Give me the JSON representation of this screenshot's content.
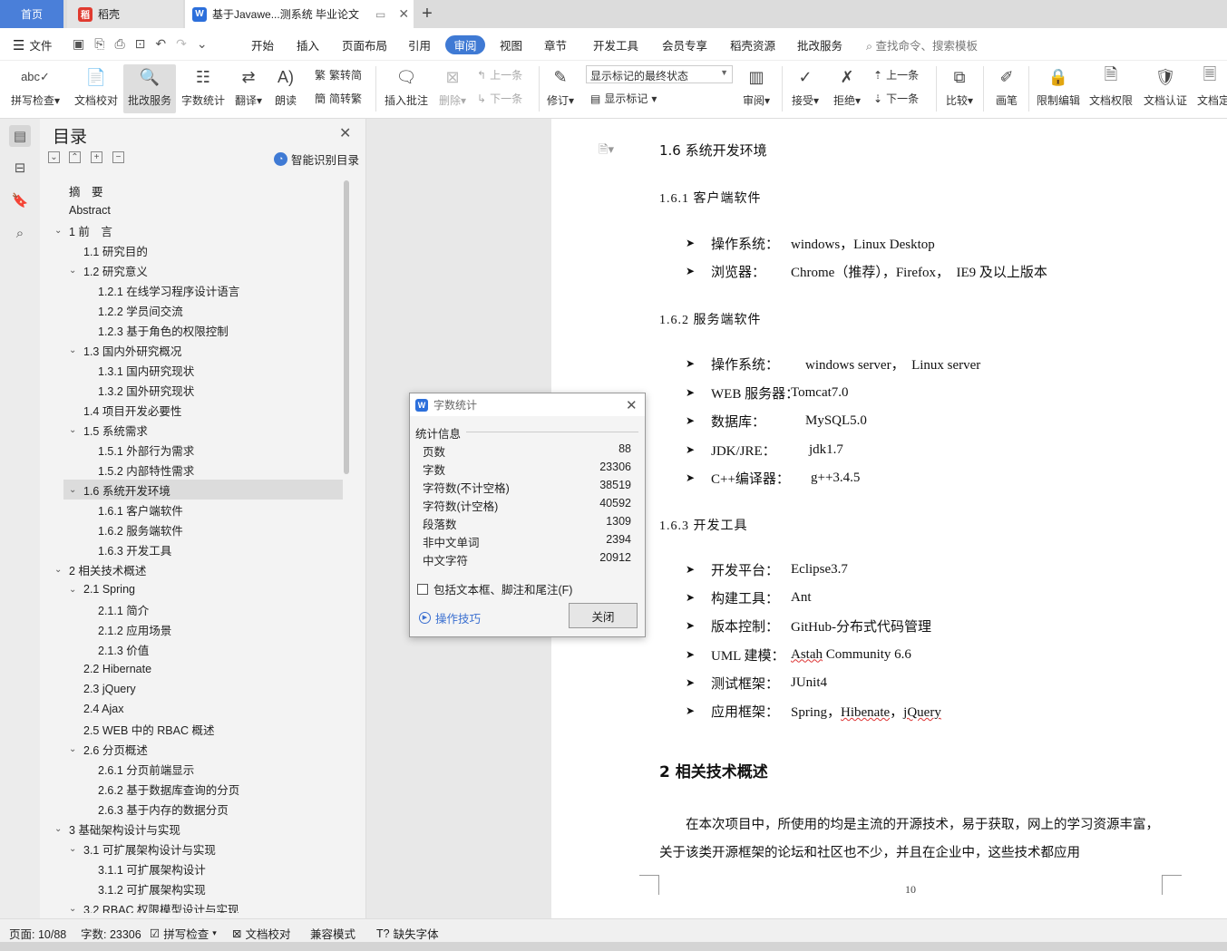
{
  "tabs": {
    "home": "首页",
    "daoke": "稻壳",
    "doc": "基于Javawe...测系统 毕业论文"
  },
  "menu": {
    "file": "文件",
    "items": [
      "开始",
      "插入",
      "页面布局",
      "引用",
      "审阅",
      "视图",
      "章节",
      "开发工具",
      "会员专享",
      "稻壳资源",
      "批改服务"
    ],
    "active": "审阅",
    "search": "查找命令、搜索模板"
  },
  "ribbon": {
    "spell_check": "拼写检查",
    "doc_check": "文档校对",
    "review_service": "批改服务",
    "word_count": "字数统计",
    "translate": "翻译",
    "read_aloud": "朗读",
    "trad_to_simp": "繁转简",
    "simp_to_trad": "简转繁",
    "insert_comment": "插入批注",
    "delete": "删除",
    "prev": "上一条",
    "next": "下一条",
    "track": "修订",
    "markup_state": "显示标记的最终状态",
    "show_markup": "显示标记",
    "review": "审阅",
    "accept": "接受",
    "reject": "拒绝",
    "prev2": "上一条",
    "next2": "下一条",
    "compare": "比较",
    "pen": "画笔",
    "restrict_edit": "限制编辑",
    "doc_rights": "文档权限",
    "doc_cert": "文档认证",
    "doc_more": "文档定"
  },
  "toc": {
    "title": "目录",
    "smart": "智能识别目录",
    "items": [
      {
        "level": 0,
        "text": "摘　要",
        "caret": ""
      },
      {
        "level": 0,
        "text": "Abstract",
        "caret": ""
      },
      {
        "level": 0,
        "text": "1 前　言",
        "caret": "v"
      },
      {
        "level": 1,
        "text": "1.1 研究目的",
        "caret": ""
      },
      {
        "level": 1,
        "text": "1.2 研究意义",
        "caret": "v"
      },
      {
        "level": 2,
        "text": "1.2.1 在线学习程序设计语言",
        "caret": ""
      },
      {
        "level": 2,
        "text": "1.2.2 学员间交流",
        "caret": ""
      },
      {
        "level": 2,
        "text": "1.2.3 基于角色的权限控制",
        "caret": ""
      },
      {
        "level": 1,
        "text": "1.3 国内外研究概况",
        "caret": "v"
      },
      {
        "level": 2,
        "text": "1.3.1 国内研究现状",
        "caret": ""
      },
      {
        "level": 2,
        "text": "1.3.2 国外研究现状",
        "caret": ""
      },
      {
        "level": 1,
        "text": "1.4 项目开发必要性",
        "caret": ""
      },
      {
        "level": 1,
        "text": "1.5 系统需求",
        "caret": "v"
      },
      {
        "level": 2,
        "text": "1.5.1 外部行为需求",
        "caret": ""
      },
      {
        "level": 2,
        "text": "1.5.2 内部特性需求",
        "caret": ""
      },
      {
        "level": 1,
        "text": "1.6 系统开发环境",
        "caret": "v",
        "selected": true
      },
      {
        "level": 2,
        "text": "1.6.1 客户端软件",
        "caret": ""
      },
      {
        "level": 2,
        "text": "1.6.2 服务端软件",
        "caret": ""
      },
      {
        "level": 2,
        "text": "1.6.3 开发工具",
        "caret": ""
      },
      {
        "level": 0,
        "text": "2 相关技术概述",
        "caret": "v"
      },
      {
        "level": 1,
        "text": "2.1 Spring",
        "caret": "v"
      },
      {
        "level": 2,
        "text": "2.1.1 简介",
        "caret": ""
      },
      {
        "level": 2,
        "text": "2.1.2 应用场景",
        "caret": ""
      },
      {
        "level": 2,
        "text": "2.1.3 价值",
        "caret": ""
      },
      {
        "level": 1,
        "text": "2.2 Hibernate",
        "caret": ""
      },
      {
        "level": 1,
        "text": "2.3 jQuery",
        "caret": ""
      },
      {
        "level": 1,
        "text": "2.4 Ajax",
        "caret": ""
      },
      {
        "level": 1,
        "text": "2.5 WEB 中的 RBAC 概述",
        "caret": ""
      },
      {
        "level": 1,
        "text": "2.6 分页概述",
        "caret": "v"
      },
      {
        "level": 2,
        "text": "2.6.1 分页前端显示",
        "caret": ""
      },
      {
        "level": 2,
        "text": "2.6.2 基于数据库查询的分页",
        "caret": ""
      },
      {
        "level": 2,
        "text": "2.6.3 基于内存的数据分页",
        "caret": ""
      },
      {
        "level": 0,
        "text": "3 基础架构设计与实现",
        "caret": "v"
      },
      {
        "level": 1,
        "text": "3.1 可扩展架构设计与实现",
        "caret": "v"
      },
      {
        "level": 2,
        "text": "3.1.1 可扩展架构设计",
        "caret": ""
      },
      {
        "level": 2,
        "text": "3.1.2 可扩展架构实现",
        "caret": ""
      },
      {
        "level": 1,
        "text": "3.2 RBAC 权限模型设计与实现",
        "caret": "v"
      }
    ]
  },
  "doc": {
    "h_16": "1.6  系统开发环境",
    "h_161": "1.6.1  客户端软件",
    "client": [
      {
        "k": "操作系统：",
        "v": "windows，Linux Desktop"
      },
      {
        "k": "浏览器：",
        "v": "Chrome（推荐），Firefox，　IE9 及以上版本"
      }
    ],
    "h_162": "1.6.2  服务端软件",
    "server": [
      {
        "k": "操作系统：",
        "v": "windows server，　Linux server"
      },
      {
        "k": "WEB 服务器：",
        "v": "Tomcat7.0"
      },
      {
        "k": "数据库：",
        "v": "MySQL5.0"
      },
      {
        "k": "JDK/JRE：",
        "v": "jdk1.7"
      },
      {
        "k": "C++编译器：",
        "v": "g++3.4.5"
      }
    ],
    "h_163": "1.6.3  开发工具",
    "tools": [
      {
        "k": "开发平台：",
        "v": "Eclipse3.7"
      },
      {
        "k": "构建工具：",
        "v": "Ant"
      },
      {
        "k": "版本控制：",
        "v": "GitHub-分布式代码管理"
      },
      {
        "k": "UML 建模：",
        "v": "Astah Community 6.6"
      },
      {
        "k": "测试框架：",
        "v": "JUnit4"
      },
      {
        "k": "应用框架：",
        "v": "Spring，Hibenate，jQuery"
      }
    ],
    "h_2": "2  相关技术概述",
    "para": "在本次项目中，所使用的均是主流的开源技术，易于获取，网上的学习资源丰富，关于该类开源框架的论坛和社区也不少，并且在企业中，这些技术都应用",
    "page_no": "10"
  },
  "dialog": {
    "title": "字数统计",
    "section": "统计信息",
    "stats": [
      {
        "k": "页数",
        "v": "88"
      },
      {
        "k": "字数",
        "v": "23306"
      },
      {
        "k": "字符数(不计空格)",
        "v": "38519"
      },
      {
        "k": "字符数(计空格)",
        "v": "40592"
      },
      {
        "k": "段落数",
        "v": "1309"
      },
      {
        "k": "非中文单词",
        "v": "2394"
      },
      {
        "k": "中文字符",
        "v": "20912"
      }
    ],
    "include": "包括文本框、脚注和尾注(F)",
    "tips": "操作技巧",
    "close": "关闭"
  },
  "status": {
    "page": "页面: 10/88",
    "words": "字数: 23306",
    "spell": "拼写检查",
    "check": "文档校对",
    "compat": "兼容模式",
    "missing_font": "缺失字体"
  },
  "colors": {
    "accent": "#3f7ad4",
    "tab_home": "#4a7fd9"
  }
}
